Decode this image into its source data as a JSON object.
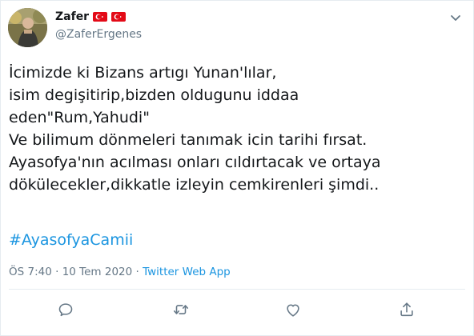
{
  "tweet": {
    "author": {
      "display_name": "Zafer",
      "handle": "@ZaferErgenes",
      "flag_icons": [
        "turkey-flag-icon",
        "turkey-flag-icon"
      ]
    },
    "lines": [
      "İcimizde ki Bizans artıgı Yunan'lılar,",
      "isim degişitirip,bizden oldugunu iddaa",
      "eden\"Rum,Yahudi\"",
      "Ve bilimum dönmeleri tanımak icin tarihi fırsat.",
      "Ayasofya'nın acılması onları cıldırtacak ve ortaya",
      "dökülecekler,dikkatle izleyin cemkirenleri şimdi.."
    ],
    "hashtag": "#AyasofyaCamii",
    "time": "ÖS 7:40",
    "separator": " · ",
    "date": "10 Tem 2020",
    "source": "Twitter Web App"
  },
  "actions": {
    "icons": [
      "reply-icon",
      "retweet-icon",
      "like-icon",
      "share-icon"
    ]
  },
  "colors": {
    "text": "#14171a",
    "secondary": "#657786",
    "link": "#1b95e0",
    "border": "#e6ecf0",
    "flag_red": "#e30a17"
  }
}
